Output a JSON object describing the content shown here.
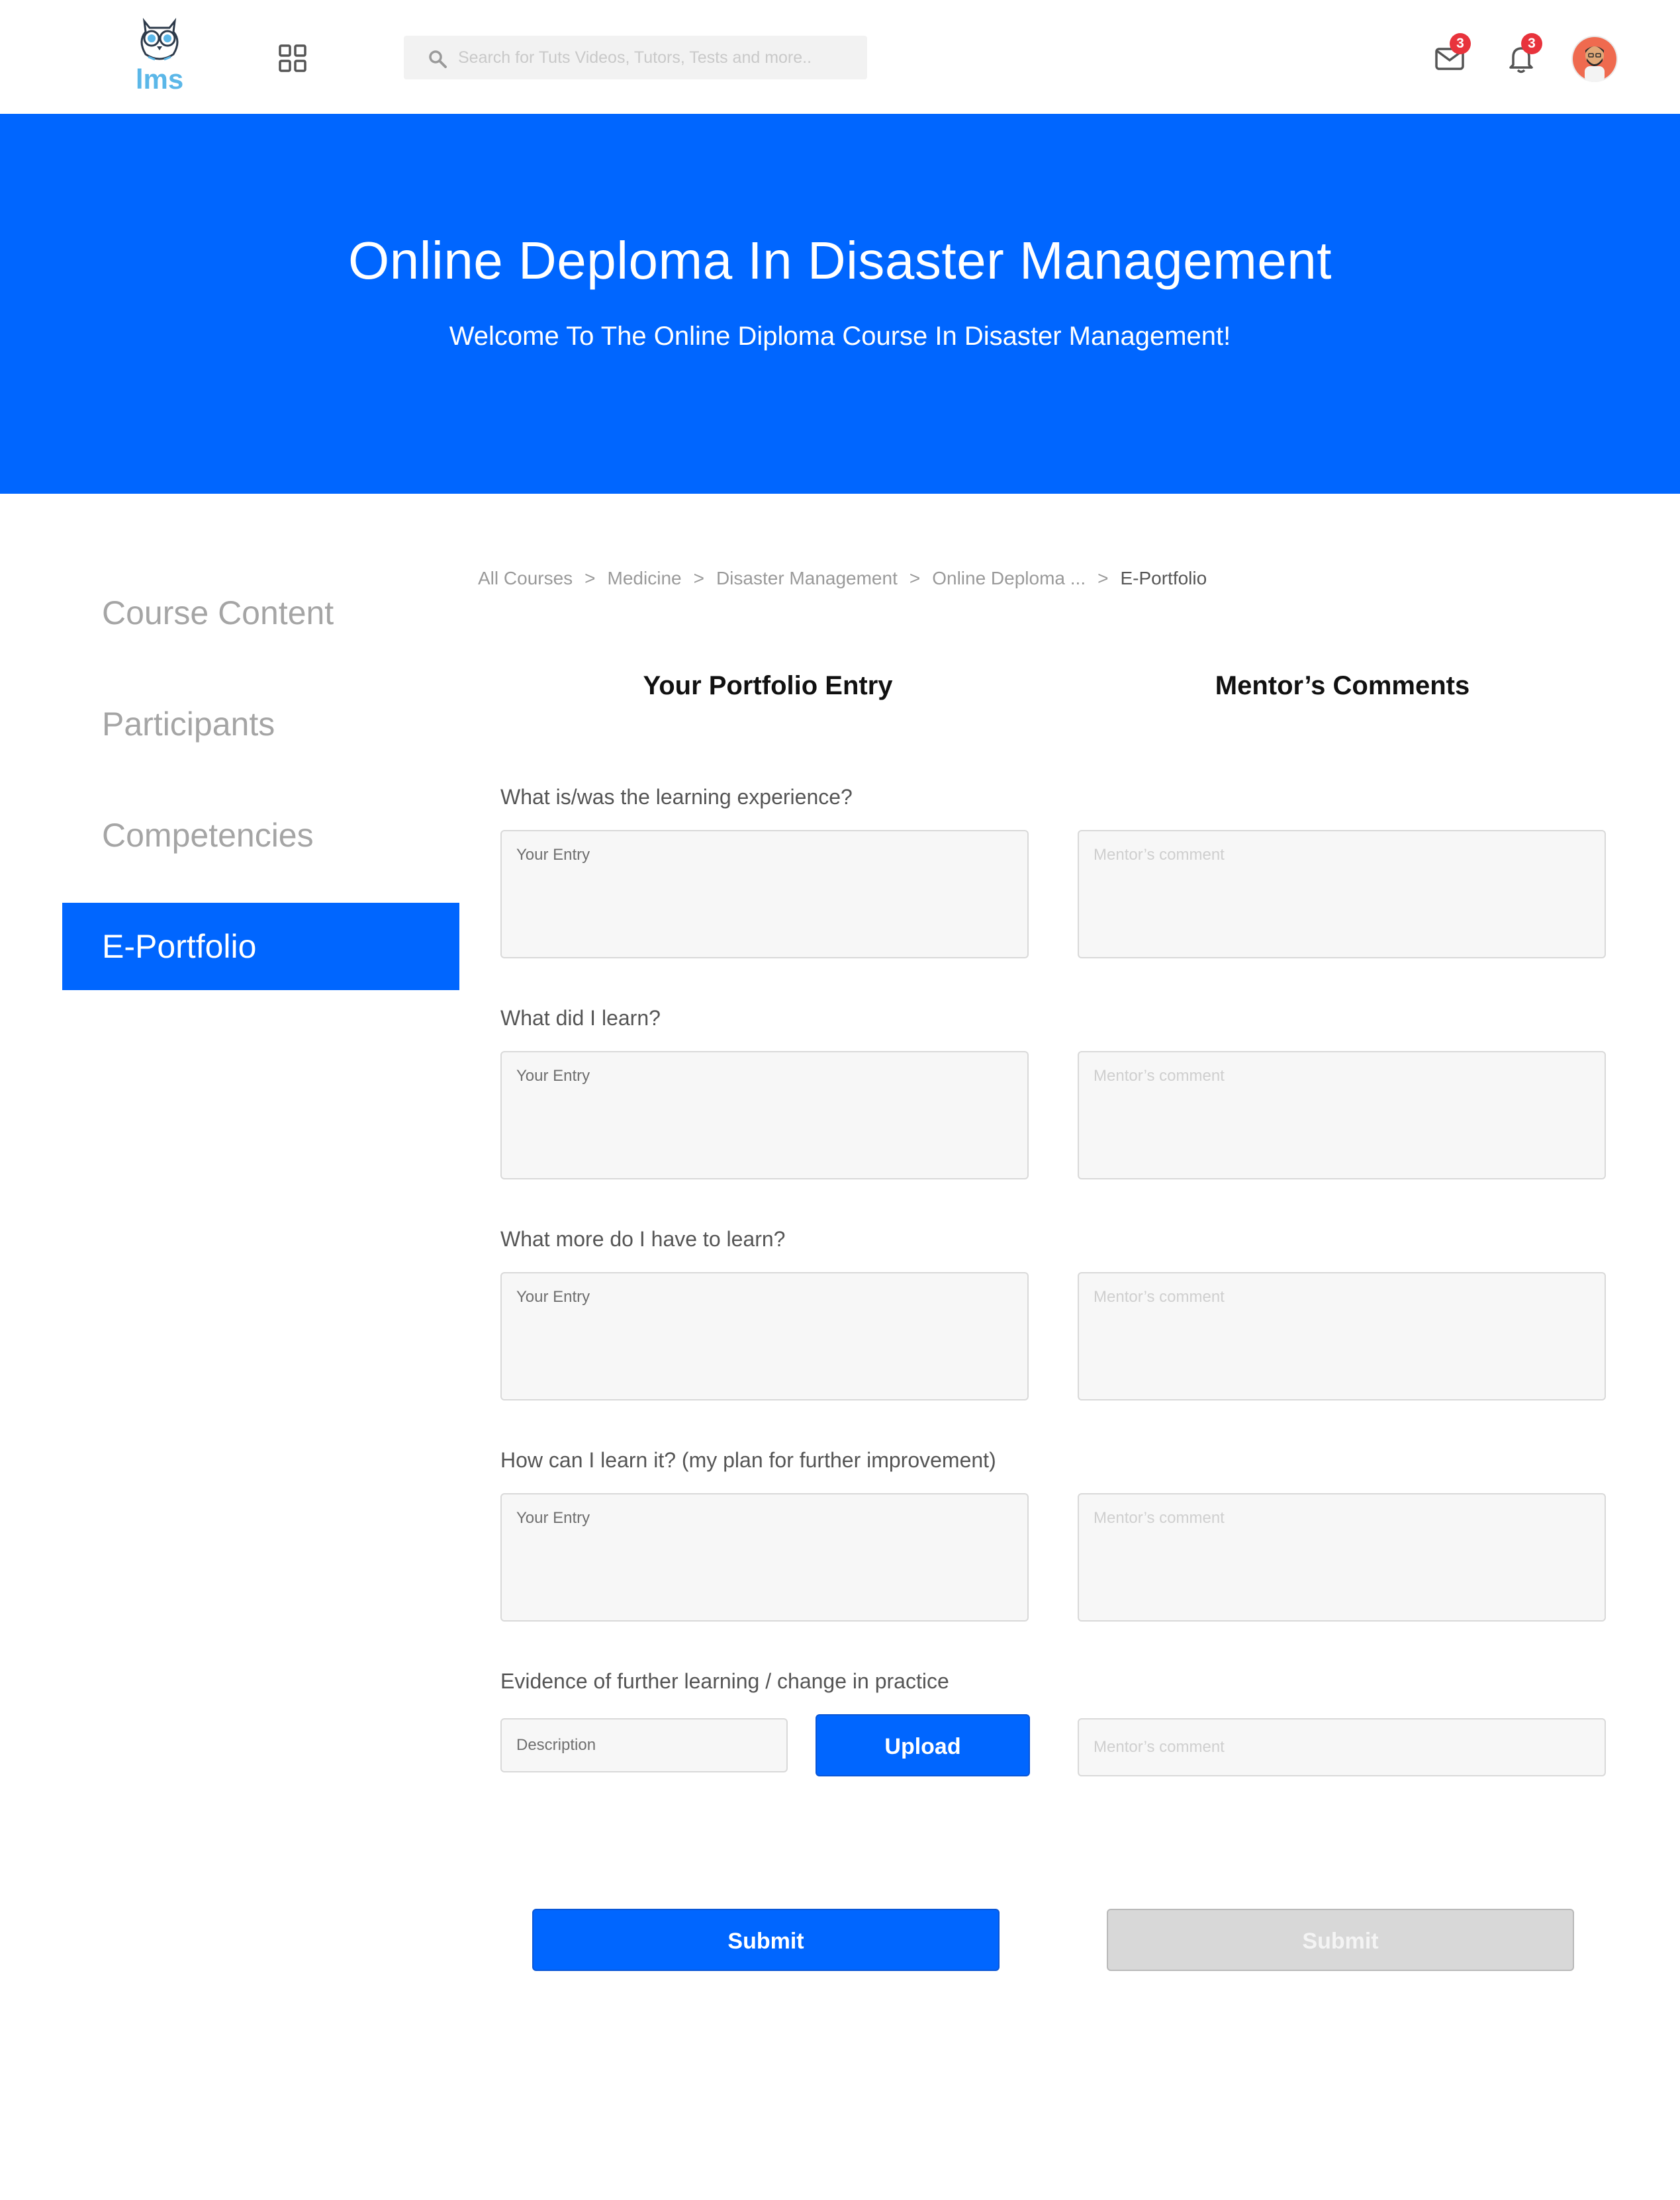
{
  "header": {
    "logo_text": "lms",
    "search_placeholder": "Search for Tuts Videos, Tutors, Tests and more..",
    "mail_badge": "3",
    "bell_badge": "3"
  },
  "hero": {
    "title": "Online Deploma In Disaster Management",
    "subtitle": "Welcome To The Online Diploma Course In Disaster Management!",
    "background_color": "#0066ff"
  },
  "sidebar": {
    "items": [
      {
        "label": "Course Content",
        "active": false
      },
      {
        "label": "Participants",
        "active": false
      },
      {
        "label": "Competencies",
        "active": false
      },
      {
        "label": "E-Portfolio",
        "active": true
      }
    ]
  },
  "breadcrumb": {
    "items": [
      "All Courses",
      "Medicine",
      "Disaster Management",
      "Online Deploma ...",
      "E-Portfolio"
    ],
    "separator": ">"
  },
  "columns": {
    "entry_heading": "Your Portfolio Entry",
    "mentor_heading": "Mentor’s Comments"
  },
  "questions": [
    {
      "label": "What is/was the learning experience?",
      "entry_placeholder": "Your Entry",
      "mentor_placeholder": "Mentor’s comment"
    },
    {
      "label": "What did I learn?",
      "entry_placeholder": "Your Entry",
      "mentor_placeholder": "Mentor’s comment"
    },
    {
      "label": "What more do I have to learn?",
      "entry_placeholder": "Your Entry",
      "mentor_placeholder": "Mentor’s comment"
    },
    {
      "label": "How can I learn it? (my plan for further improvement)",
      "entry_placeholder": "Your Entry",
      "mentor_placeholder": "Mentor’s comment"
    }
  ],
  "evidence": {
    "label": "Evidence of further learning / change in practice",
    "description_placeholder": "Description",
    "upload_label": "Upload",
    "mentor_placeholder": "Mentor’s comment"
  },
  "actions": {
    "submit_label": "Submit",
    "mentor_submit_label": "Submit"
  }
}
